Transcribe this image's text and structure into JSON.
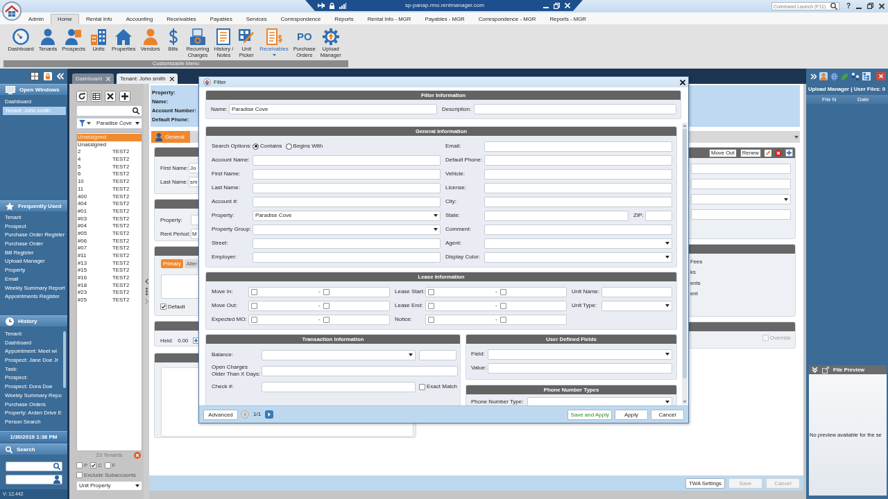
{
  "title_bar": {
    "remote_host": "sp-panap.rmo.rentmanager.com",
    "command_launch": {
      "placeholder": "Command Launch (F11)"
    },
    "help": "?"
  },
  "ribbon": {
    "tabs": [
      {
        "label": "Admin",
        "selected": false
      },
      {
        "label": "Home",
        "selected": true
      },
      {
        "label": "Rental Info",
        "selected": false
      },
      {
        "label": "Accounting",
        "selected": false
      },
      {
        "label": "Receivables",
        "selected": false
      },
      {
        "label": "Payables",
        "selected": false
      },
      {
        "label": "Services",
        "selected": false
      },
      {
        "label": "Correspondence",
        "selected": false
      },
      {
        "label": "Reports",
        "selected": false
      },
      {
        "label": "Rental Info - MGR",
        "selected": false
      },
      {
        "label": "Payables - MGR",
        "selected": false
      },
      {
        "label": "Correspondence - MGR",
        "selected": false
      },
      {
        "label": "Reports - MGR",
        "selected": false
      }
    ],
    "buttons": [
      {
        "label": "Dashboard",
        "selected": false,
        "menu": false
      },
      {
        "label": "Tenants",
        "selected": false,
        "menu": false
      },
      {
        "label": "Prospects",
        "selected": false,
        "menu": false
      },
      {
        "label": "Units",
        "selected": false,
        "menu": false
      },
      {
        "label": "Properties",
        "selected": false,
        "menu": false
      },
      {
        "label": "Vendors",
        "selected": false,
        "menu": false
      },
      {
        "label": "Bills",
        "selected": false,
        "menu": false
      },
      {
        "label": "Recurring\nCharges",
        "selected": false,
        "menu": false
      },
      {
        "label": "History /\nNotes",
        "selected": false,
        "menu": false
      },
      {
        "label": "Unit\nPicker",
        "selected": false,
        "menu": false
      },
      {
        "label": "Receivables",
        "selected": true,
        "menu": true
      },
      {
        "label": "Purchase\nOrders",
        "icon_text": "PO",
        "selected": false,
        "menu": false
      },
      {
        "label": "Upload\nManager",
        "selected": false,
        "menu": false
      }
    ],
    "group_label": "Customizable Menu"
  },
  "sidebar": {
    "open_windows": {
      "title": "Open Windows",
      "items": [
        {
          "label": "Dashboard",
          "selected": false
        },
        {
          "label": "Tenant: John smith",
          "selected": true
        }
      ]
    },
    "frequently_used": {
      "title": "Frequently Used",
      "items": [
        "Tenant",
        "Prospect",
        "Purchase Order Register",
        "Purchase Order",
        "Bill Register",
        "Upload Manager",
        "Property",
        "Email",
        "Weekly Summary Report",
        "Appointments Register"
      ]
    },
    "history": {
      "title": "History",
      "items": [
        "Tenant:",
        "Dashboard",
        "Appointment: Meet wi",
        "Prospect: Jane Doe Jr",
        "Task:",
        "Prospect:",
        "Prospect: Dora Doe",
        "Weekly Summary Repo",
        "Purchase Orders",
        "Property: Arden Drive E",
        "Person Search"
      ]
    },
    "clock": "1/30/2019 1:38 PM",
    "search": {
      "title": "Search"
    },
    "version": "V: 12.442"
  },
  "document_tabs": [
    {
      "label": "Dashboard",
      "selected": false
    },
    {
      "label": "Tenant: John smith",
      "selected": true
    }
  ],
  "tenant_list": {
    "filter": {
      "value": "Paradise Cove"
    },
    "rows": [
      {
        "cells": [
          "Unassigned"
        ],
        "selected": true
      },
      {
        "cells": [
          "Unassigned"
        ],
        "selected": false
      },
      {
        "cells": [
          "2",
          "TEST2"
        ],
        "selected": false
      },
      {
        "cells": [
          "4",
          "TEST2"
        ],
        "selected": false
      },
      {
        "cells": [
          "5",
          "TEST2"
        ],
        "selected": false
      },
      {
        "cells": [
          "6",
          "TEST2"
        ],
        "selected": false
      },
      {
        "cells": [
          "10",
          "TEST2"
        ],
        "selected": false
      },
      {
        "cells": [
          "11",
          "TEST2"
        ],
        "selected": false
      },
      {
        "cells": [
          "400",
          "TEST2"
        ],
        "selected": false
      },
      {
        "cells": [
          "404",
          "TEST2"
        ],
        "selected": false
      },
      {
        "cells": [
          "#01",
          "TEST2"
        ],
        "selected": false
      },
      {
        "cells": [
          "#03",
          "TEST2"
        ],
        "selected": false
      },
      {
        "cells": [
          "#04",
          "TEST2"
        ],
        "selected": false
      },
      {
        "cells": [
          "#05",
          "TEST2"
        ],
        "selected": false
      },
      {
        "cells": [
          "#06",
          "TEST2"
        ],
        "selected": false
      },
      {
        "cells": [
          "#07",
          "TEST2"
        ],
        "selected": false
      },
      {
        "cells": [
          "#11",
          "TEST2"
        ],
        "selected": false
      },
      {
        "cells": [
          "#13",
          "TEST2"
        ],
        "selected": false
      },
      {
        "cells": [
          "#15",
          "TEST2"
        ],
        "selected": false
      },
      {
        "cells": [
          "#16",
          "TEST2"
        ],
        "selected": false
      },
      {
        "cells": [
          "#18",
          "TEST2"
        ],
        "selected": false
      },
      {
        "cells": [
          "#23",
          "TEST2"
        ],
        "selected": false
      },
      {
        "cells": [
          "#25",
          "TEST2"
        ],
        "selected": false
      }
    ],
    "count": "23 Tenants",
    "type_filters": [
      {
        "label": "P",
        "checked": false
      },
      {
        "label": "C",
        "checked": true
      },
      {
        "label": "F",
        "checked": false
      }
    ],
    "exclude_subaccounts": {
      "label": "Exclude Subaccounts",
      "checked": false
    },
    "sort": {
      "value": "Unit Property"
    }
  },
  "tenant_detail": {
    "summary_labels": [
      "Property:",
      "Name:",
      "Account Number:",
      "Default Phone:"
    ],
    "tabs": [
      {
        "label": "General",
        "selected": true
      }
    ],
    "name_fields": [
      {
        "label": "First Name:",
        "value": "Jo"
      },
      {
        "label": "Last Name:",
        "value": "sm"
      }
    ],
    "lease_fields": [
      {
        "label": "Property:"
      },
      {
        "label": "Rent Period:",
        "value": "M"
      }
    ],
    "contact_tabs": [
      {
        "label": "Primary",
        "selected": true
      },
      {
        "label": "Alter",
        "selected": false
      }
    ],
    "default_contact": {
      "label": "Default",
      "checked": true
    },
    "deposit": {
      "label": "Held:",
      "value": "0.00"
    },
    "lease_actions": [
      "Move Out",
      "Renew"
    ],
    "lease_rows": [
      {
        "kind": "text"
      },
      {
        "kind": "text"
      },
      {
        "kind": "dropdown"
      },
      {
        "kind": "text"
      }
    ],
    "charge_items": [
      "Fees",
      "ks",
      "ents",
      "ent"
    ],
    "override": {
      "label": "Override",
      "checked": false,
      "disabled": true
    },
    "actions": [
      {
        "label": "TWA Settings",
        "disabled": false
      },
      {
        "label": "Save",
        "disabled": true
      },
      {
        "label": "Cancel",
        "disabled": true
      }
    ]
  },
  "upload_manager": {
    "title": "Upload Manager ( User Files: 0",
    "columns": [
      "File N",
      "Date"
    ],
    "preview": {
      "title": "File Preview",
      "message": "No preview available for the se"
    }
  },
  "filter_dialog": {
    "title": "Filter",
    "filter_information": {
      "title": "Filter Information",
      "name": {
        "label": "Name:",
        "value": "Paradise Cove"
      },
      "description": {
        "label": "Description:"
      }
    },
    "general_information": {
      "title": "General Information",
      "search_options": {
        "label": "Search Options:",
        "options": [
          {
            "label": "Contains",
            "selected": true
          },
          {
            "label": "Begins With",
            "selected": false
          }
        ]
      },
      "left_fields": [
        {
          "label": "Account Name:",
          "kind": "text"
        },
        {
          "label": "First Name:",
          "kind": "text"
        },
        {
          "label": "Last Name:",
          "kind": "text"
        },
        {
          "label": "Account #:",
          "kind": "text"
        },
        {
          "label": "Property:",
          "kind": "dropdown",
          "value": "Paradise Cove"
        },
        {
          "label": "Property Group:",
          "kind": "dropdown"
        },
        {
          "label": "Street:",
          "kind": "text"
        },
        {
          "label": "Employer:",
          "kind": "text"
        }
      ],
      "right_fields": [
        {
          "label": "Email:",
          "kind": "text"
        },
        {
          "label": "Default Phone:",
          "kind": "text"
        },
        {
          "label": "Vehicle:",
          "kind": "text"
        },
        {
          "label": "License:",
          "kind": "text"
        },
        {
          "label": "City:",
          "kind": "text"
        },
        {
          "label": "State:",
          "kind": "state_zip",
          "zip_label": "ZIP:"
        },
        {
          "label": "Comment:",
          "kind": "text"
        },
        {
          "label": "Agent:",
          "kind": "dropdown"
        },
        {
          "label": "Display Color:",
          "kind": "dropdown"
        }
      ]
    },
    "lease_information": {
      "title": "Lease Information",
      "columns": [
        {
          "fields": [
            {
              "label": "Move In:",
              "kind": "date_range",
              "separator": "-",
              "from_checked": false,
              "to_checked": false
            },
            {
              "label": "Move Out:",
              "kind": "date_range",
              "separator": "-",
              "from_checked": false,
              "to_checked": false
            },
            {
              "label": "Expected MO:",
              "kind": "date_range",
              "separator": "-",
              "from_checked": false,
              "to_checked": false
            }
          ]
        },
        {
          "fields": [
            {
              "label": "Lease Start:",
              "kind": "date_range",
              "separator": "-",
              "from_checked": false,
              "to_checked": false
            },
            {
              "label": "Lease End:",
              "kind": "date_range",
              "separator": "-",
              "from_checked": false,
              "to_checked": false
            },
            {
              "label": "Notice:",
              "kind": "date_range",
              "separator": "-",
              "from_checked": false,
              "to_checked": false
            }
          ]
        },
        {
          "fields": [
            {
              "label": "Unit Name:",
              "kind": "text"
            },
            {
              "label": "Unit Type:",
              "kind": "dropdown"
            }
          ]
        }
      ]
    },
    "transaction_information": {
      "title": "Transaction Information",
      "rows": [
        {
          "label": "Balance:",
          "kind": "balance"
        },
        {
          "label": "Open Charges Older Than X Days:",
          "kind": "text"
        },
        {
          "label": "Check #:",
          "kind": "check",
          "option": {
            "label": "Exact Match",
            "checked": false
          }
        }
      ]
    },
    "user_defined_fields": {
      "title": "User Defined Fields",
      "rows": [
        {
          "label": "Field:",
          "kind": "dropdown"
        },
        {
          "label": "Value:",
          "kind": "text"
        }
      ]
    },
    "phone_number_types": {
      "title": "Phone Number Types",
      "rows": [
        {
          "label": "Phone Number Type:",
          "kind": "dropdown"
        }
      ]
    },
    "footer": {
      "advanced": "Advanced",
      "page": "1/1",
      "prev_disabled": true,
      "next_disabled": false,
      "buttons": [
        {
          "label": "Save and Apply",
          "kind": "save"
        },
        {
          "label": "Apply",
          "kind": "plain"
        },
        {
          "label": "Cancel",
          "kind": "plain"
        }
      ]
    }
  }
}
